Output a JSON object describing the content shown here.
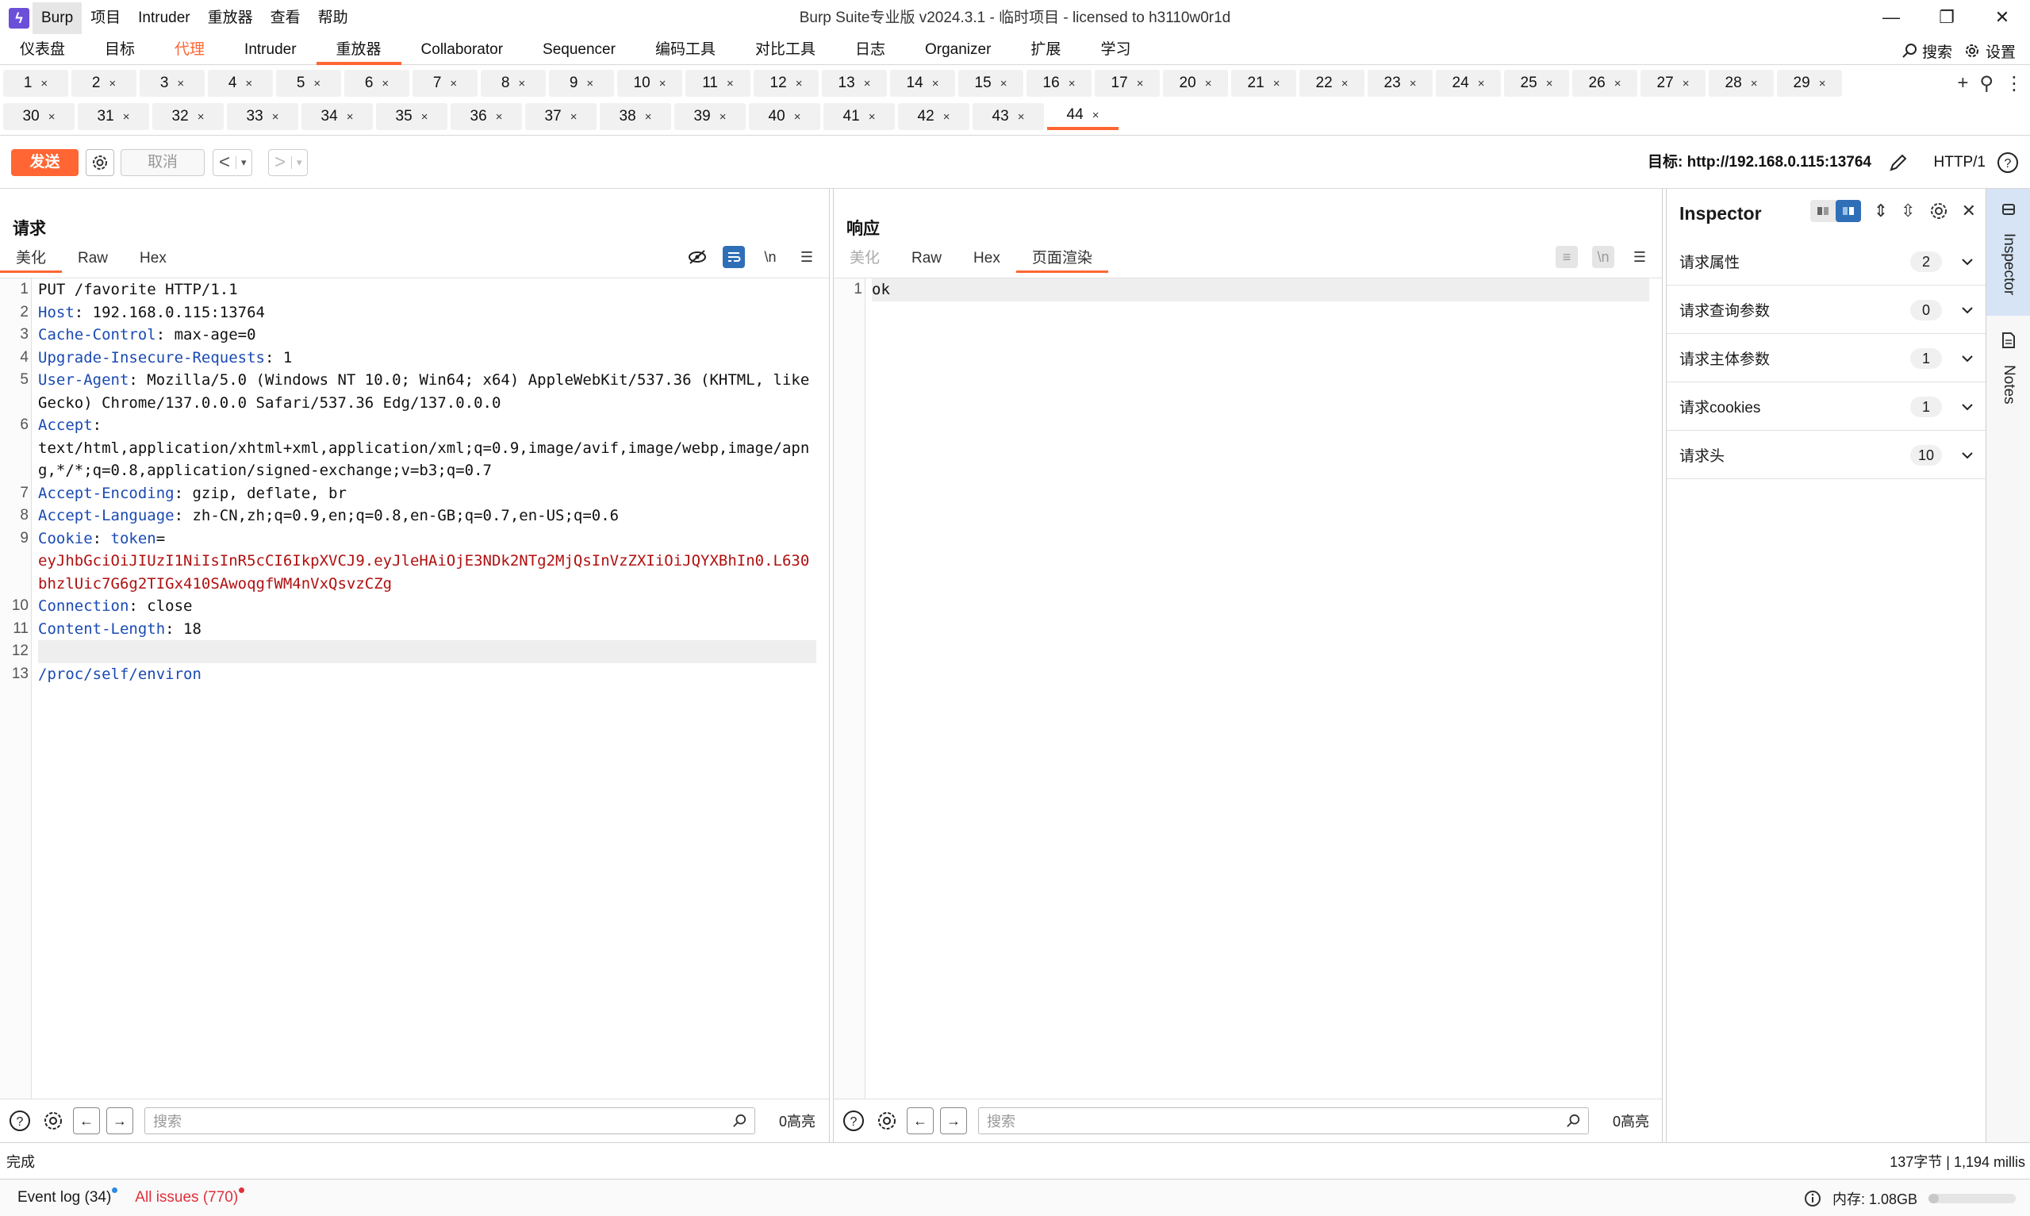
{
  "window": {
    "title": "Burp Suite专业版  v2024.3.1 - 临时项目 - licensed to h3110w0r1d",
    "logo": "lightning-icon",
    "minimize": "—",
    "restore": "❐",
    "close": "✕"
  },
  "menu": [
    "Burp",
    "项目",
    "Intruder",
    "重放器",
    "查看",
    "帮助"
  ],
  "primary_tabs": [
    "仪表盘",
    "目标",
    "代理",
    "Intruder",
    "重放器",
    "Collaborator",
    "Sequencer",
    "编码工具",
    "对比工具",
    "日志",
    "Organizer",
    "扩展",
    "学习"
  ],
  "primary_tab_selected": "重放器",
  "top_tools": {
    "search": "搜索",
    "settings": "设置"
  },
  "repeater_tabs_row1": [
    "1",
    "2",
    "3",
    "4",
    "5",
    "6",
    "7",
    "8",
    "9",
    "10",
    "11",
    "12",
    "13",
    "14",
    "15",
    "16",
    "17",
    "20",
    "21",
    "22",
    "23",
    "24",
    "25",
    "26",
    "27",
    "28",
    "29"
  ],
  "repeater_tabs_row2": [
    "30",
    "31",
    "32",
    "33",
    "34",
    "35",
    "36",
    "37",
    "38",
    "39",
    "40",
    "41",
    "42",
    "43",
    "44"
  ],
  "repeater_tab_selected": "44",
  "tab_close": "×",
  "tab_row_tools": {
    "add": "+",
    "search": "⚲",
    "more": "⋮"
  },
  "toolbar": {
    "send": "发送",
    "cancel": "取消",
    "back": "<",
    "forward": ">",
    "dropdown": "▾",
    "target": "目标: http://192.168.0.115:13764",
    "http_version": "HTTP/1"
  },
  "request": {
    "title": "请求",
    "tabs": [
      "美化",
      "Raw",
      "Hex"
    ],
    "selected_tab": "美化",
    "newline_toggle": "\\n",
    "lines": [
      {
        "n": "1",
        "parts": [
          {
            "t": "PUT /favorite HTTP/1.1",
            "c": ""
          }
        ]
      },
      {
        "n": "2",
        "parts": [
          {
            "t": "Host",
            "c": "hname"
          },
          {
            "t": ": 192.168.0.115:13764",
            "c": ""
          }
        ]
      },
      {
        "n": "3",
        "parts": [
          {
            "t": "Cache-Control",
            "c": "hname"
          },
          {
            "t": ": max-age=0",
            "c": ""
          }
        ]
      },
      {
        "n": "4",
        "parts": [
          {
            "t": "Upgrade-Insecure-Requests",
            "c": "hname"
          },
          {
            "t": ": 1",
            "c": ""
          }
        ]
      },
      {
        "n": "5",
        "parts": [
          {
            "t": "User-Agent",
            "c": "hname"
          },
          {
            "t": ": Mozilla/5.0 (Windows NT 10.0; Win64; x64) AppleWebKit/537.36 (KHTML, like Gecko) Chrome/137.0.0.0 Safari/537.36 Edg/137.0.0.0",
            "c": ""
          }
        ]
      },
      {
        "n": "6",
        "parts": [
          {
            "t": "Accept",
            "c": "hname"
          },
          {
            "t": ":\ntext/html,application/xhtml+xml,application/xml;q=0.9,image/avif,image/webp,image/apng,*/*;q=0.8,application/signed-exchange;v=b3;q=0.7",
            "c": ""
          }
        ]
      },
      {
        "n": "7",
        "parts": [
          {
            "t": "Accept-Encoding",
            "c": "hname"
          },
          {
            "t": ": gzip, deflate, br",
            "c": ""
          }
        ]
      },
      {
        "n": "8",
        "parts": [
          {
            "t": "Accept-Language",
            "c": "hname"
          },
          {
            "t": ": zh-CN,zh;q=0.9,en;q=0.8,en-GB;q=0.7,en-US;q=0.6",
            "c": ""
          }
        ]
      },
      {
        "n": "9",
        "parts": [
          {
            "t": "Cookie",
            "c": "hname"
          },
          {
            "t": ": ",
            "c": ""
          },
          {
            "t": "token",
            "c": "hname"
          },
          {
            "t": "=\n",
            "c": ""
          },
          {
            "t": "eyJhbGciOiJIUzI1NiIsInR5cCI6IkpXVCJ9.eyJleHAiOjE3NDk2NTg2MjQsInVzZXIiOiJQYXBhIn0.L630bhzlUic7G6g2TIGx410SAwoqgfWM4nVxQsvzCZg",
            "c": "cookieval"
          }
        ]
      },
      {
        "n": "10",
        "parts": [
          {
            "t": "Connection",
            "c": "hname"
          },
          {
            "t": ": close",
            "c": ""
          }
        ]
      },
      {
        "n": "11",
        "parts": [
          {
            "t": "Content-Length",
            "c": "hname"
          },
          {
            "t": ": 18",
            "c": ""
          }
        ]
      },
      {
        "n": "12",
        "parts": [
          {
            "t": "",
            "c": ""
          }
        ],
        "hl": true
      },
      {
        "n": "13",
        "parts": [
          {
            "t": "/proc/self/environ",
            "c": "path"
          }
        ]
      }
    ],
    "search_placeholder": "搜索",
    "highlight_count": "0高亮"
  },
  "response": {
    "title": "响应",
    "tabs": [
      "美化",
      "Raw",
      "Hex",
      "页面渲染"
    ],
    "selected_tab": "页面渲染",
    "lines": [
      {
        "n": "1",
        "parts": [
          {
            "t": "ok",
            "c": ""
          }
        ],
        "hl": true
      }
    ],
    "search_placeholder": "搜索",
    "highlight_count": "0高亮"
  },
  "inspector": {
    "title": "Inspector",
    "rows": [
      {
        "label": "请求属性",
        "count": "2"
      },
      {
        "label": "请求查询参数",
        "count": "0"
      },
      {
        "label": "请求主体参数",
        "count": "1"
      },
      {
        "label": "请求cookies",
        "count": "1"
      },
      {
        "label": "请求头",
        "count": "10"
      }
    ]
  },
  "side_rail": [
    "Inspector",
    "Notes"
  ],
  "status": {
    "text": "完成",
    "response_size": "137字节 | 1,194 millis"
  },
  "bottom": {
    "event_log": "Event log (34)",
    "issues": "All issues (770)",
    "memory": "内存: 1.08GB",
    "memory_fraction": 0.12
  },
  "colors": {
    "accent": "#ff6633",
    "header_name": "#1a4ab3",
    "cookie_value": "#b01010",
    "event_dot": "#2f8ae0",
    "issues_text": "#e0303a",
    "selected_blue": "#2f6fb7"
  }
}
